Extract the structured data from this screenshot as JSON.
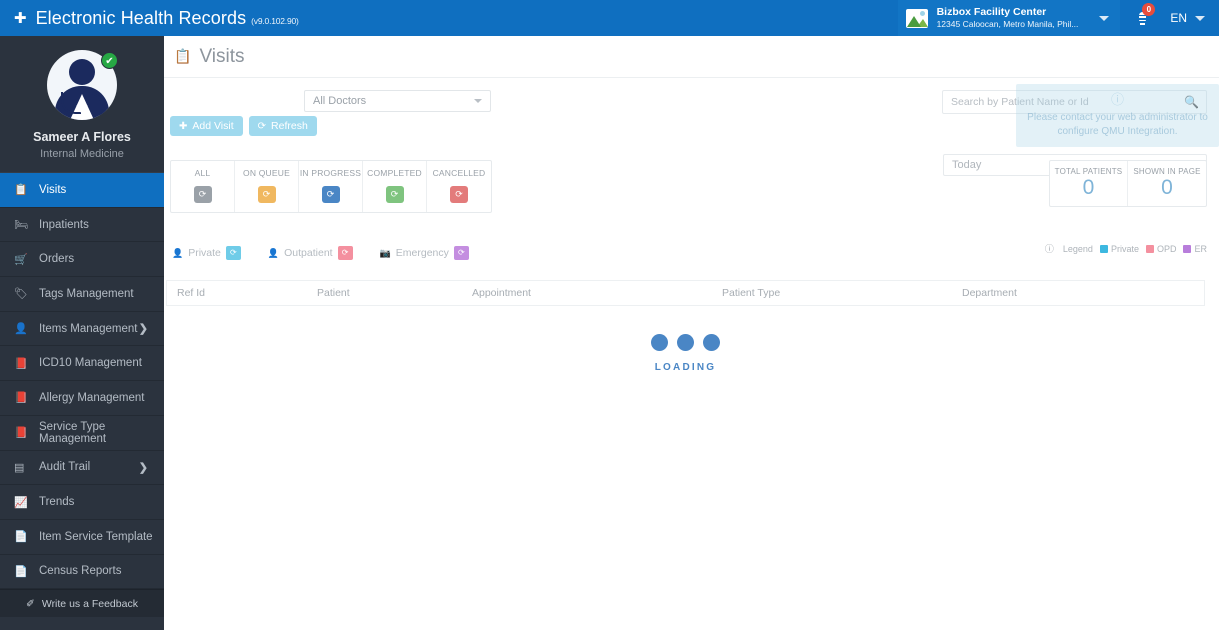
{
  "topbar": {
    "brand_icon": "plus-icon",
    "title": "Electronic Health Records",
    "version": "(v9.0.102.90)",
    "facility_name": "Bizbox Facility Center",
    "facility_address": "12345 Caloocan, Metro Manila, Phil...",
    "notification_count": "0",
    "language": "EN",
    "brand_color": "#0f6fc0"
  },
  "sidebar": {
    "profile": {
      "name": "Sameer A Flores",
      "role": "Internal Medicine",
      "status_badge": "check-icon"
    },
    "items": [
      {
        "label": "Visits",
        "icon": "clipboard-icon",
        "active": true,
        "has_arrow": false
      },
      {
        "label": "Inpatients",
        "icon": "bed-icon",
        "active": false,
        "has_arrow": false
      },
      {
        "label": "Orders",
        "icon": "cart-icon",
        "active": false,
        "has_arrow": false
      },
      {
        "label": "Tags Management",
        "icon": "tag-icon",
        "active": false,
        "has_arrow": false
      },
      {
        "label": "Items Management",
        "icon": "user-icon",
        "active": false,
        "has_arrow": true
      },
      {
        "label": "ICD10 Management",
        "icon": "book-icon",
        "active": false,
        "has_arrow": false
      },
      {
        "label": "Allergy Management",
        "icon": "book-icon",
        "active": false,
        "has_arrow": false
      },
      {
        "label": "Service Type Management",
        "icon": "book-icon",
        "active": false,
        "has_arrow": false
      },
      {
        "label": "Audit Trail",
        "icon": "list-icon",
        "active": false,
        "has_arrow": true
      },
      {
        "label": "Trends",
        "icon": "chart-line-icon",
        "active": false,
        "has_arrow": false
      },
      {
        "label": "Item Service Template",
        "icon": "file-icon",
        "active": false,
        "has_arrow": false
      },
      {
        "label": "Census Reports",
        "icon": "file-icon",
        "active": false,
        "has_arrow": false
      }
    ],
    "feedback_label": "Write us a Feedback",
    "feedback_icon": "pencil-square-icon"
  },
  "page": {
    "title": "Visits",
    "title_icon": "clipboard-icon"
  },
  "toolbar": {
    "doctor_filter_value": "All Doctors",
    "add_visit_label": "Add Visit",
    "refresh_label": "Refresh",
    "add_visit_icon": "plus-icon",
    "refresh_icon": "refresh-icon",
    "button_color": "#9fd9ee"
  },
  "search": {
    "placeholder": "Search by Patient Name or Id",
    "value": "",
    "icon": "search-icon"
  },
  "tooltip": {
    "icon": "info-circle-icon",
    "text": "Please contact your web administrator to configure QMU Integration."
  },
  "date_filter": {
    "value": "Today",
    "icon": "chevron-down-icon"
  },
  "status_cards": [
    {
      "label": "ALL",
      "badge_icon": "spinner-icon",
      "color": "#9aa1a8"
    },
    {
      "label": "ON QUEUE",
      "badge_icon": "spinner-icon",
      "color": "#f0b860"
    },
    {
      "label": "IN PROGRESS",
      "badge_icon": "spinner-icon",
      "color": "#4a86c5"
    },
    {
      "label": "COMPLETED",
      "badge_icon": "spinner-icon",
      "color": "#7fc47f"
    },
    {
      "label": "CANCELLED",
      "badge_icon": "spinner-icon",
      "color": "#e37b7b"
    }
  ],
  "stats": [
    {
      "label": "TOTAL PATIENTS",
      "value": "0"
    },
    {
      "label": "SHOWN IN PAGE",
      "value": "0"
    }
  ],
  "legend": {
    "label": "Legend",
    "icon": "info-circle-icon",
    "items": [
      {
        "label": "Private",
        "color": "#3db8e0"
      },
      {
        "label": "OPD",
        "color": "#f4909f"
      },
      {
        "label": "ER",
        "color": "#b87ddb"
      }
    ]
  },
  "type_tabs": [
    {
      "label": "Private",
      "icon": "user-md-icon",
      "badge_icon": "spinner-icon",
      "color": "#6fcce8"
    },
    {
      "label": "Outpatient",
      "icon": "user-icon",
      "badge_icon": "spinner-icon",
      "color": "#f4909f"
    },
    {
      "label": "Emergency",
      "icon": "briefcase-medical-icon",
      "badge_icon": "spinner-icon",
      "color": "#c48ee0"
    }
  ],
  "table": {
    "columns": [
      "Ref Id",
      "Patient",
      "Appointment",
      "Patient Type",
      "Department"
    ],
    "rows": []
  },
  "loading": {
    "text": "LOADING",
    "dot_color": "#4a86c5"
  }
}
